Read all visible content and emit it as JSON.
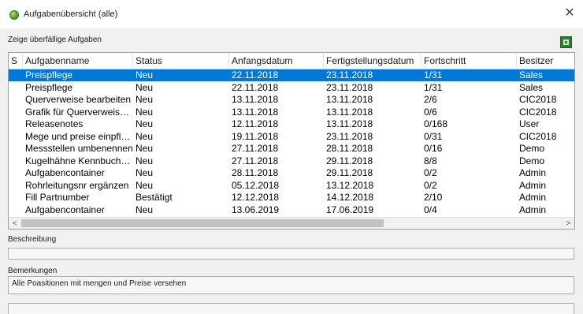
{
  "window": {
    "title": "Aufgabenübersicht (alle)",
    "app_icon": "green-globe-icon",
    "close_icon": "close-icon",
    "close_glyph": "✕"
  },
  "filter": {
    "label": "Zeige überfällige Aufgaben"
  },
  "toolbar": {
    "export_icon": "excel-export-icon"
  },
  "table": {
    "columns": [
      "S",
      "Aufgabenname",
      "Status",
      "Anfangsdatum",
      "Fertigstellungsdatum",
      "Fortschritt",
      "Besitzer"
    ],
    "rows": [
      [
        "",
        "Preispflege",
        "Neu",
        "22.11.2018",
        "23.11.2018",
        "1/31",
        "Sales"
      ],
      [
        "",
        "Preispflege",
        "Neu",
        "22.11.2018",
        "23.11.2018",
        "1/31",
        "Sales"
      ],
      [
        "",
        "Querverweise bearbeiten",
        "Neu",
        "13.11.2018",
        "13.11.2018",
        "2/6",
        "CIC2018"
      ],
      [
        "",
        "Grafik für Querverweise ände...",
        "Neu",
        "13.11.2018",
        "13.11.2018",
        "0/6",
        "CIC2018"
      ],
      [
        "",
        "Releasenotes",
        "Neu",
        "12.11.2018",
        "13.11.2018",
        "0/168",
        "User"
      ],
      [
        "",
        "Mege und preise einpflegen",
        "Neu",
        "19.11.2018",
        "23.11.2018",
        "0/31",
        "CIC2018"
      ],
      [
        "",
        "Messstellen umbenennen",
        "Neu",
        "27.11.2018",
        "28.11.2018",
        "0/16",
        "Demo"
      ],
      [
        "",
        "Kugelhähne Kennbuchstabe ...",
        "Neu",
        "27.11.2018",
        "29.11.2018",
        "8/8",
        "Demo"
      ],
      [
        "",
        "Aufgabencontainer",
        "Neu",
        "28.11.2018",
        "29.11.2018",
        "0/2",
        "Admin"
      ],
      [
        "",
        "Rohrleitungsnr ergänzen",
        "Neu",
        "05.12.2018",
        "13.12.2018",
        "0/2",
        "Admin"
      ],
      [
        "",
        "Fill Partnumber",
        "Bestätigt",
        "12.12.2018",
        "14.12.2018",
        "2/10",
        "Admin"
      ],
      [
        "",
        "Aufgabencontainer",
        "Neu",
        "13.06.2019",
        "17.06.2019",
        "0/4",
        "Admin"
      ]
    ],
    "selected_row": 0,
    "scroll_left_glyph": "<",
    "scroll_right_glyph": ">",
    "selection_color": "#0078d7"
  },
  "description": {
    "label": "Beschreibung",
    "value": ""
  },
  "remarks": {
    "label": "Bemerkungen",
    "value": "Alle Poasitionen mit mengen und Preise versehen"
  }
}
